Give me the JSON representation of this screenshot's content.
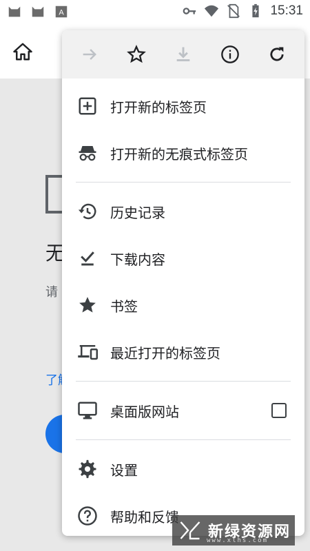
{
  "status_bar": {
    "time": "15:31",
    "left_icons": [
      "cat-icon",
      "cat-icon",
      "app-icon"
    ],
    "right_icons": [
      "key-icon",
      "wifi-icon",
      "no-sim-icon",
      "battery-charging-icon"
    ]
  },
  "toolbar": {
    "home_icon": "home-icon"
  },
  "background_page": {
    "title_partial": "无",
    "subtitle_partial": "请",
    "link_partial": "了解"
  },
  "menu": {
    "top_actions": [
      {
        "name": "forward",
        "icon": "arrow-right-icon",
        "enabled": false
      },
      {
        "name": "bookmark",
        "icon": "star-outline-icon",
        "enabled": true
      },
      {
        "name": "download",
        "icon": "download-icon",
        "enabled": false
      },
      {
        "name": "info",
        "icon": "info-icon",
        "enabled": true
      },
      {
        "name": "reload",
        "icon": "reload-icon",
        "enabled": true
      }
    ],
    "items": [
      {
        "label": "打开新的标签页",
        "icon": "add-box-icon"
      },
      {
        "label": "打开新的无痕式标签页",
        "icon": "incognito-icon"
      },
      {
        "label": "历史记录",
        "icon": "history-icon"
      },
      {
        "label": "下载内容",
        "icon": "download-done-icon"
      },
      {
        "label": "书签",
        "icon": "star-icon"
      },
      {
        "label": "最近打开的标签页",
        "icon": "devices-icon"
      },
      {
        "label": "桌面版网站",
        "icon": "monitor-icon",
        "checkbox": false
      },
      {
        "label": "设置",
        "icon": "gear-icon"
      },
      {
        "label": "帮助和反馈",
        "icon": "help-icon"
      }
    ]
  },
  "watermark": {
    "text": "新绿资源网",
    "sub": "www.xlhs.com"
  },
  "colors": {
    "icon_dark": "#3c4043",
    "icon_disabled": "#bdc1c6",
    "accent": "#1a73e8"
  }
}
